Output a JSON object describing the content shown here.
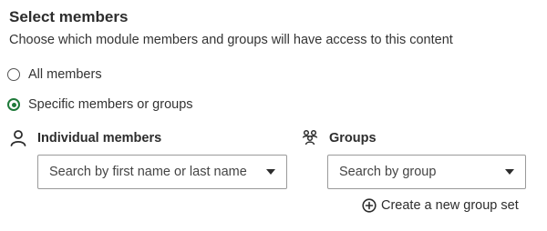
{
  "header": {
    "title": "Select members",
    "description": "Choose which module members and groups will have access to this content"
  },
  "access_options": [
    {
      "label": "All members",
      "selected": false
    },
    {
      "label": "Specific members or groups",
      "selected": true
    }
  ],
  "individual": {
    "label": "Individual members",
    "icon": "person-icon",
    "select_text": "Search by first name or last name"
  },
  "groups": {
    "label": "Groups",
    "icon": "group-icon",
    "select_text": "Search by group"
  },
  "create_group": {
    "label": "Create a new group set",
    "icon": "plus-circle-icon"
  },
  "colors": {
    "accent": "#1f7a3a",
    "text": "#2d2d2d",
    "border": "#9a9a9a"
  }
}
